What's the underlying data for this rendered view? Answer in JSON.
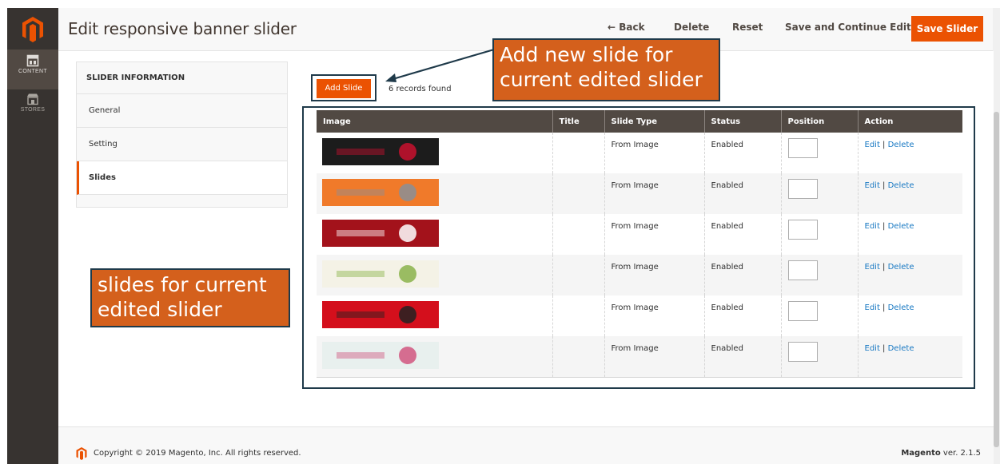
{
  "nav": {
    "items": [
      {
        "label": "CONTENT",
        "icon": "content-icon"
      },
      {
        "label": "STORES",
        "icon": "stores-icon"
      }
    ]
  },
  "header": {
    "title": "Edit responsive banner slider",
    "back": "← Back",
    "delete": "Delete",
    "reset": "Reset",
    "save_continue": "Save and Continue Edit",
    "save": "Save Slider"
  },
  "tabs": {
    "title": "SLIDER INFORMATION",
    "items": [
      "General",
      "Setting",
      "Slides"
    ]
  },
  "grid": {
    "add_slide": "Add Slide",
    "records": "6 records found",
    "columns": [
      "Image",
      "Title",
      "Slide Type",
      "Status",
      "Position",
      "Action"
    ],
    "rows": [
      {
        "title": "",
        "type": "From Image",
        "status": "Enabled",
        "position": "",
        "edit": "Edit",
        "delete": "Delete",
        "thumb_color": "#1c1c1c",
        "accent": "#c8102e"
      },
      {
        "title": "",
        "type": "From Image",
        "status": "Enabled",
        "position": "",
        "edit": "Edit",
        "delete": "Delete",
        "thumb_color": "#f07a2a",
        "accent": "#8a8f96"
      },
      {
        "title": "",
        "type": "From Image",
        "status": "Enabled",
        "position": "",
        "edit": "Edit",
        "delete": "Delete",
        "thumb_color": "#a3121b",
        "accent": "#ffffff"
      },
      {
        "title": "",
        "type": "From Image",
        "status": "Enabled",
        "position": "",
        "edit": "Edit",
        "delete": "Delete",
        "thumb_color": "#f4f2e6",
        "accent": "#8ab34a"
      },
      {
        "title": "",
        "type": "From Image",
        "status": "Enabled",
        "position": "",
        "edit": "Edit",
        "delete": "Delete",
        "thumb_color": "#d40f1c",
        "accent": "#222222"
      },
      {
        "title": "",
        "type": "From Image",
        "status": "Enabled",
        "position": "",
        "edit": "Edit",
        "delete": "Delete",
        "thumb_color": "#e8f0ee",
        "accent": "#d1567f"
      }
    ]
  },
  "callouts": {
    "top": "Add new slide for current edited slider",
    "left": "slides for current edited slider"
  },
  "footer": {
    "copyright": "Copyright © 2019 Magento, Inc. All rights reserved.",
    "brand": "Magento",
    "version": " ver. 2.1.5"
  },
  "colors": {
    "accent": "#eb5202",
    "nav_bg": "#373330",
    "callout": "#d4601c",
    "link": "#1979c3"
  }
}
